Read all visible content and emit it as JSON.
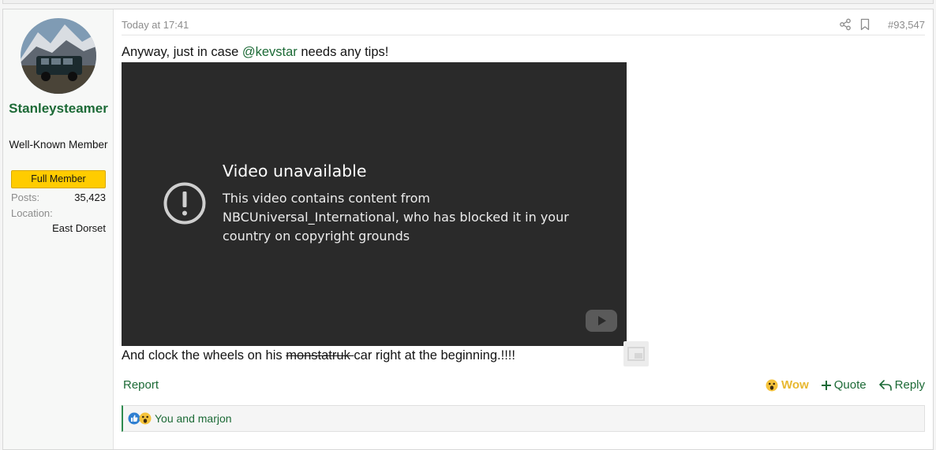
{
  "post": {
    "date": "Today at 17:41",
    "number": "#93,547",
    "icons": {
      "share": "share-icon",
      "bookmark": "bookmark-icon"
    }
  },
  "user": {
    "name": "Stanleysteamer",
    "title": "Well-Known Member",
    "banner": "Full Member",
    "stats": [
      {
        "label": "Posts:",
        "value": "35,423"
      },
      {
        "label": "Location:",
        "value": "East Dorset"
      }
    ],
    "avatar_icon": "car-on-mountain-avatar"
  },
  "message": {
    "line1_before": "Anyway, just in case ",
    "line1_mention": "@kevstar",
    "line1_after": " needs any tips!",
    "line2_before": "And clock the wheels on his ",
    "line2_strike": "monstatruk ",
    "line2_after": "car right at the beginning.!!!!"
  },
  "video": {
    "title": "Video unavailable",
    "description": "This video contains content from NBCUniversal_International, who has blocked it in your country on copyright grounds",
    "icons": {
      "warning": "exclamation-circle-icon",
      "logo": "youtube-logo-icon"
    }
  },
  "actions": {
    "report": "Report",
    "wow": "Wow",
    "quote": "Quote",
    "reply": "Reply"
  },
  "reactions": {
    "summary": "You and marjon",
    "icons": [
      "thumbs-up-icon",
      "wow-face-icon"
    ]
  },
  "colors": {
    "accent": "#1c6a36",
    "banner": "#ffcc00",
    "wow": "#e8b830",
    "video_bg": "#2a2a2a"
  }
}
